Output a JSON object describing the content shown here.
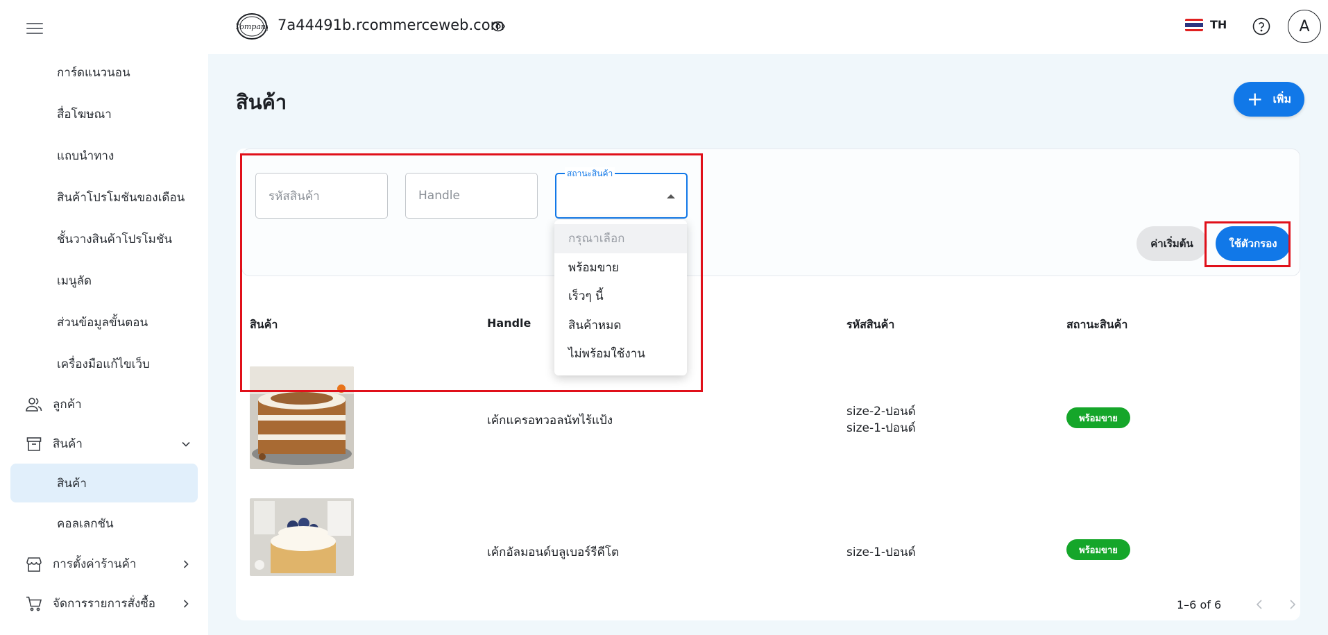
{
  "header": {
    "domain": "7a44491b.rcommerceweb.com",
    "logo_text": "Company",
    "language": "TH",
    "avatar_letter": "A"
  },
  "sidebar": {
    "sub_items_top": [
      {
        "label": "การ์ดแนวนอน"
      },
      {
        "label": "สื่อโฆษณา"
      },
      {
        "label": "แถบนำทาง"
      },
      {
        "label": "สินค้าโปรโมชันของเดือน"
      },
      {
        "label": "ชั้นวางสินค้าโปรโมชัน"
      },
      {
        "label": "เมนูลัด"
      },
      {
        "label": "ส่วนข้อมูลขั้นตอน"
      },
      {
        "label": "เครื่องมือแก้ไขเว็บ"
      }
    ],
    "customers": {
      "label": "ลูกค้า",
      "icon": "people-icon"
    },
    "products": {
      "label": "สินค้า",
      "icon": "archive-box-icon"
    },
    "products_sub": [
      {
        "label": "สินค้า",
        "active": true
      },
      {
        "label": "คอลเลกชัน"
      }
    ],
    "store_settings": {
      "label": "การตั้งค่าร้านค้า",
      "icon": "store-icon"
    },
    "orders": {
      "label": "จัดการรายการสั่งซื้อ",
      "icon": "cart-icon"
    }
  },
  "page": {
    "title": "สินค้า",
    "add_label": "เพิ่ม"
  },
  "filters": {
    "sku_placeholder": "รหัสสินค้า",
    "handle_placeholder": "Handle",
    "status_label": "สถานะสินค้า",
    "reset_label": "ค่าเริ่มต้น",
    "apply_label": "ใช้ตัวกรอง"
  },
  "dropdown": {
    "options": [
      {
        "label": "กรุณาเลือก",
        "placeholder": true
      },
      {
        "label": "พร้อมขาย"
      },
      {
        "label": "เร็วๆ นี้"
      },
      {
        "label": "สินค้าหมด"
      },
      {
        "label": "ไม่พร้อมใช้งาน"
      }
    ]
  },
  "table": {
    "headers": {
      "product": "สินค้า",
      "handle": "Handle",
      "sku": "รหัสสินค้า",
      "status": "สถานะสินค้า"
    },
    "rows": [
      {
        "handle": "เค้กแครอทวอลนัทไร้แป้ง",
        "sku_1": "size-2-ปอนด์",
        "sku_2": "size-1-ปอนด์",
        "status": "พร้อมขาย"
      },
      {
        "handle": "เค้กอัลมอนด์บลูเบอร์รีคีโต",
        "sku_1": "size-1-ปอนด์",
        "status": "พร้อมขาย"
      }
    ],
    "status_color": "#15a62a"
  },
  "pagination": {
    "range": "1–6 of 6"
  },
  "colors": {
    "accent": "#1178e8",
    "highlight": "#e0101a",
    "active_nav": "#e1effb"
  }
}
